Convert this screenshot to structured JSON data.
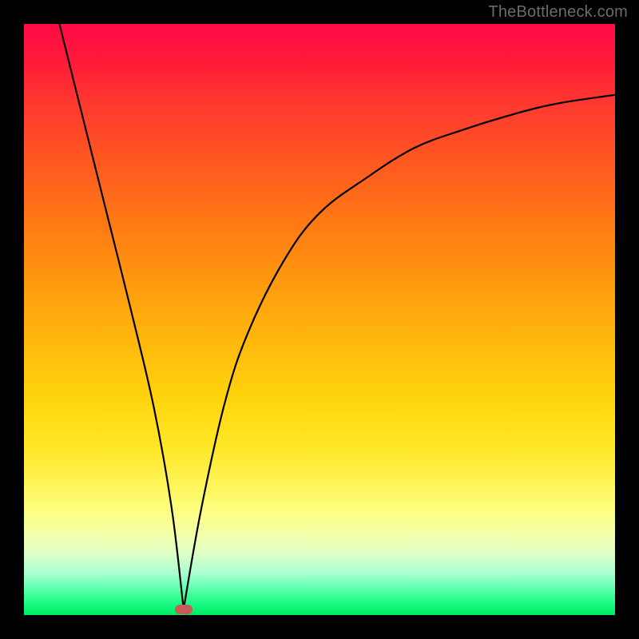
{
  "watermark": "TheBottleneck.com",
  "colors": {
    "frame": "#000000",
    "curve": "#000000",
    "bump": "#c85a5a",
    "gradient_top": "#ff0a46",
    "gradient_bottom": "#02e860"
  },
  "chart_data": {
    "type": "line",
    "title": "",
    "xlabel": "",
    "ylabel": "",
    "xlim": [
      0,
      100
    ],
    "ylim": [
      0,
      100
    ],
    "annotations": [
      "TheBottleneck.com"
    ],
    "series": [
      {
        "name": "left-branch",
        "x": [
          6,
          10,
          14,
          18,
          22,
          25,
          27
        ],
        "values": [
          100,
          84,
          68,
          52,
          35,
          18,
          1
        ]
      },
      {
        "name": "right-branch",
        "x": [
          27,
          30,
          34,
          38,
          44,
          50,
          58,
          66,
          74,
          82,
          90,
          100
        ],
        "values": [
          1,
          18,
          36,
          48,
          60,
          68,
          74,
          79,
          82,
          84.5,
          86.5,
          88
        ]
      }
    ],
    "marker": {
      "name": "bump",
      "x": 27,
      "y": 1
    }
  }
}
